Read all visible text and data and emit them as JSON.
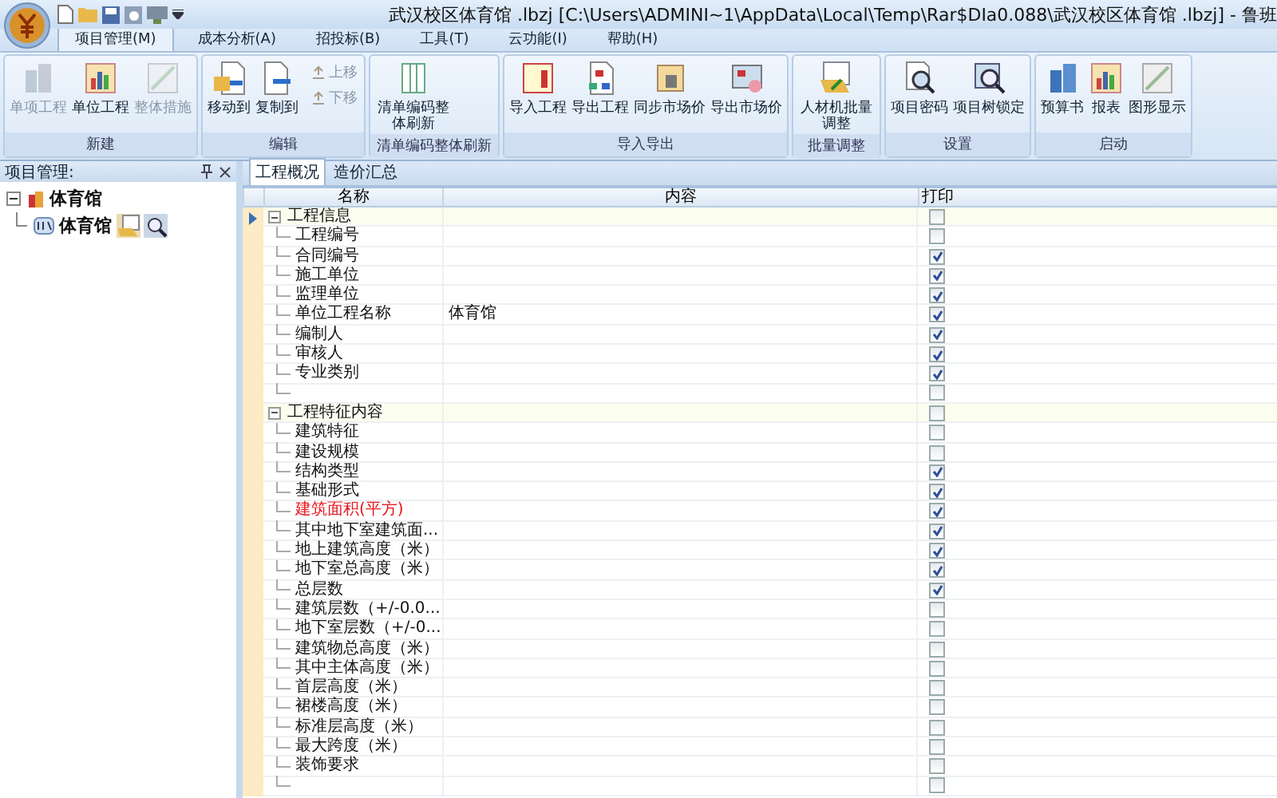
{
  "window": {
    "title": "武汉校区体育馆 .lbzj [C:\\Users\\ADMINI~1\\AppData\\Local\\Temp\\Rar$DIa0.088\\武汉校区体育馆 .lbzj] - 鲁班"
  },
  "ribbon_tabs": [
    {
      "label": "项目管理(M)",
      "selected": true
    },
    {
      "label": "成本分析(A)",
      "selected": false
    },
    {
      "label": "招投标(B)",
      "selected": false
    },
    {
      "label": "工具(T)",
      "selected": false
    },
    {
      "label": "云功能(I)",
      "selected": false
    },
    {
      "label": "帮助(H)",
      "selected": false
    }
  ],
  "ribbon_groups": [
    {
      "label": "新建",
      "buttons": [
        {
          "label": "单项工程",
          "kind": "large",
          "disabled": true
        },
        {
          "label": "单位工程",
          "kind": "large",
          "disabled": false
        },
        {
          "label": "整体措施",
          "kind": "large",
          "disabled": true
        }
      ]
    },
    {
      "label": "编辑",
      "buttons": [
        {
          "label": "移动到",
          "kind": "large",
          "disabled": false
        },
        {
          "label": "复制到",
          "kind": "large",
          "disabled": false
        },
        {
          "label": "上移",
          "kind": "small",
          "disabled": true
        },
        {
          "label": "下移",
          "kind": "small",
          "disabled": true
        }
      ]
    },
    {
      "label": "清单编码整体刷新",
      "buttons": [
        {
          "label": "清单编码整体刷新",
          "kind": "large",
          "disabled": false
        }
      ]
    },
    {
      "label": "导入导出",
      "buttons": [
        {
          "label": "导入工程",
          "kind": "large",
          "disabled": false
        },
        {
          "label": "导出工程",
          "kind": "large",
          "disabled": false
        },
        {
          "label": "同步市场价",
          "kind": "large",
          "disabled": false
        },
        {
          "label": "导出市场价",
          "kind": "large",
          "disabled": false
        }
      ]
    },
    {
      "label": "批量调整",
      "buttons": [
        {
          "label": "人材机批量调整",
          "kind": "large",
          "disabled": false
        }
      ]
    },
    {
      "label": "设置",
      "buttons": [
        {
          "label": "项目密码",
          "kind": "large",
          "disabled": false
        },
        {
          "label": "项目树锁定",
          "kind": "large",
          "disabled": false
        }
      ]
    },
    {
      "label": "启动",
      "buttons": [
        {
          "label": "预算书",
          "kind": "large",
          "disabled": false
        },
        {
          "label": "报表",
          "kind": "large",
          "disabled": false
        },
        {
          "label": "图形显示",
          "kind": "large",
          "disabled": false
        }
      ]
    }
  ],
  "project_panel": {
    "title": "项目管理:",
    "tree": [
      {
        "label": "体育馆",
        "expanded": true,
        "children": [
          {
            "label": "体育馆"
          }
        ]
      }
    ]
  },
  "content_tabs": [
    {
      "label": "工程概况",
      "selected": true
    },
    {
      "label": "造价汇总",
      "selected": false
    }
  ],
  "grid": {
    "columns": [
      "名称",
      "内容",
      "打印"
    ],
    "rows": [
      {
        "kind": "group",
        "name": "工程信息",
        "expanded": true,
        "print": false,
        "selected": true,
        "children": [
          {
            "kind": "item",
            "name": "工程编号",
            "print": false,
            "selected": false,
            "emphasized": false
          },
          {
            "kind": "item",
            "name": "合同编号",
            "print": true,
            "selected": false,
            "emphasized": false
          },
          {
            "kind": "item",
            "name": "施工单位",
            "print": true,
            "selected": false,
            "emphasized": false
          },
          {
            "kind": "item",
            "name": "监理单位",
            "print": true,
            "selected": false,
            "emphasized": false
          },
          {
            "kind": "item",
            "name": "单位工程名称",
            "value": "体育馆",
            "print": true,
            "selected": false,
            "emphasized": false
          },
          {
            "kind": "item",
            "name": "编制人",
            "print": true,
            "selected": false,
            "emphasized": false
          },
          {
            "kind": "item",
            "name": "审核人",
            "print": true,
            "selected": false,
            "emphasized": false
          },
          {
            "kind": "item",
            "name": "专业类别",
            "print": true,
            "selected": false,
            "emphasized": false
          },
          {
            "kind": "blank",
            "print": false,
            "selected": false,
            "emphasized": false
          }
        ]
      },
      {
        "kind": "group",
        "name": "工程特征内容",
        "expanded": true,
        "print": false,
        "selected": false,
        "children": [
          {
            "kind": "item",
            "name": "建筑特征",
            "print": false,
            "selected": false,
            "emphasized": false
          },
          {
            "kind": "item",
            "name": "建设规模",
            "print": false,
            "selected": false,
            "emphasized": false
          },
          {
            "kind": "item",
            "name": "结构类型",
            "print": true,
            "selected": false,
            "emphasized": false
          },
          {
            "kind": "item",
            "name": "基础形式",
            "print": true,
            "selected": false,
            "emphasized": false
          },
          {
            "kind": "item",
            "name": "建筑面积(平方)",
            "print": true,
            "selected": false,
            "emphasized": true
          },
          {
            "kind": "item",
            "name": "其中地下室建筑面...",
            "print": true,
            "selected": false,
            "emphasized": false
          },
          {
            "kind": "item",
            "name": "地上建筑高度（米）",
            "print": true,
            "selected": false,
            "emphasized": false
          },
          {
            "kind": "item",
            "name": "地下室总高度（米）",
            "print": true,
            "selected": false,
            "emphasized": false
          },
          {
            "kind": "item",
            "name": "总层数",
            "print": true,
            "selected": false,
            "emphasized": false
          },
          {
            "kind": "item",
            "name": "建筑层数（+/-0.0...",
            "print": false,
            "selected": false,
            "emphasized": false
          },
          {
            "kind": "item",
            "name": "地下室层数（+/-0...",
            "print": false,
            "selected": false,
            "emphasized": false
          },
          {
            "kind": "item",
            "name": "建筑物总高度（米）",
            "print": false,
            "selected": false,
            "emphasized": false
          },
          {
            "kind": "item",
            "name": "其中主体高度（米）",
            "print": false,
            "selected": false,
            "emphasized": false
          },
          {
            "kind": "item",
            "name": "首层高度（米）",
            "print": false,
            "selected": false,
            "emphasized": false
          },
          {
            "kind": "item",
            "name": "裙楼高度（米）",
            "print": false,
            "selected": false,
            "emphasized": false
          },
          {
            "kind": "item",
            "name": "标准层高度（米）",
            "print": false,
            "selected": false,
            "emphasized": false
          },
          {
            "kind": "item",
            "name": "最大跨度（米）",
            "print": false,
            "selected": false,
            "emphasized": false
          },
          {
            "kind": "item",
            "name": "装饰要求",
            "print": false,
            "selected": false,
            "emphasized": false
          },
          {
            "kind": "blank",
            "print": false,
            "selected": false,
            "emphasized": false
          }
        ]
      }
    ]
  }
}
